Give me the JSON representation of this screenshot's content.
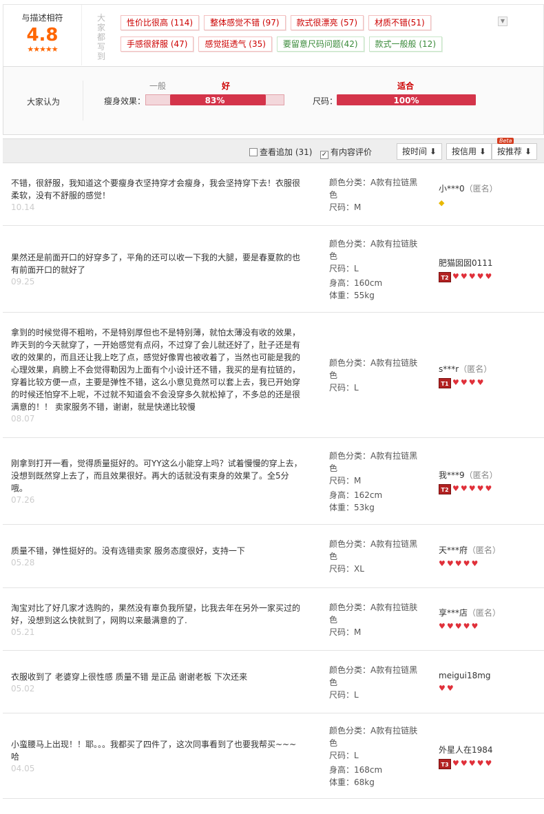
{
  "summary": {
    "score_label": "与描述相符",
    "score": "4.8",
    "stars": "★★★★★",
    "side_label": "大家都写到",
    "tags": [
      {
        "text": "性价比很高 (114)",
        "sentiment": "positive"
      },
      {
        "text": "整体感觉不错 (97)",
        "sentiment": "positive"
      },
      {
        "text": "款式很漂亮 (57)",
        "sentiment": "positive"
      },
      {
        "text": "材质不错(51)",
        "sentiment": "positive"
      },
      {
        "text": "手感很舒服 (47)",
        "sentiment": "positive"
      },
      {
        "text": "感觉挺透气 (35)",
        "sentiment": "positive"
      },
      {
        "text": "要留意尺码问题(42)",
        "sentiment": "negative"
      },
      {
        "text": "款式一般般 (12)",
        "sentiment": "negative"
      }
    ],
    "expand_icon": "chevron-down-icon"
  },
  "opinion": {
    "title": "大家认为",
    "slimming": {
      "label": "瘦身效果：",
      "low_text": "一般",
      "high_text": "好",
      "percent": "83%",
      "fill": 0.83
    },
    "size": {
      "label": "尺码：",
      "high_text": "适合",
      "percent": "100%",
      "fill": 1.0
    }
  },
  "filters": {
    "followup_label": "查看追加 (31)",
    "followup_checked": false,
    "content_label": "有内容评价",
    "content_checked": true,
    "sort_time": "按时间",
    "sort_credit": "按信用",
    "sort_recommend": "按推荐",
    "beta": "Beta"
  },
  "reviews": [
    {
      "text": "不错，很舒服，我知道这个要瘦身衣坚持穿才会瘦身，我会坚持穿下去！衣服很柔软，没有不舒服的感觉！",
      "date": "10.14",
      "color_label": "颜色分类：",
      "color": "A款有拉链黑色",
      "size_label": "尺码：",
      "size": "M",
      "height": "",
      "weight": "",
      "user": "小***0",
      "anon": "（匿名）",
      "level": "",
      "hearts": 0,
      "diamonds": 1
    },
    {
      "text": "果然还是前面开口的好穿多了，平角的还可以收一下我的大腿，要是春夏款的也有前面开口的就好了",
      "date": "09.25",
      "color_label": "颜色分类：",
      "color": "A款有拉链肤色",
      "size_label": "尺码：",
      "size": "L",
      "height_label": "身高：",
      "height": "160cm",
      "weight_label": "体重：",
      "weight": "55kg",
      "user": "肥猫囡囡0111",
      "anon": "",
      "level": "T2",
      "hearts": 5,
      "diamonds": 0
    },
    {
      "text": "拿到的时候觉得不粗哟，不是特别厚但也不是特别薄，就怕太薄没有收的效果，昨天到的今天就穿了，一开始感觉有点闷，不过穿了会儿就还好了，肚子还是有收的效果的，而且还让我上吃了点，感觉好像胃也被收着了，当然也可能是我的心理效果，肩膀上不会觉得勒因为上面有个小设计还不错，我买的是有拉链的，穿着比较方便一点，主要是弹性不错，这么小意见竟然可以套上去，我已开始穿的时候还怕穿不上呢，不过就不知道会不会没穿多久就松掉了，不多总的还是很满意的！！ 卖家服务不错，谢谢，就是快递比较慢",
      "date": "08.07",
      "color_label": "颜色分类：",
      "color": "A款有拉链肤色",
      "size_label": "尺码：",
      "size": "L",
      "height": "",
      "weight": "",
      "user": "s***r",
      "anon": "（匿名）",
      "level": "T1",
      "hearts": 4,
      "diamonds": 0
    },
    {
      "text": "刚拿到打开一看，觉得质量挺好的。可YY这么小能穿上吗？试着慢慢的穿上去，没想到既然穿上去了，而且效果很好。再大的话就没有束身的效果了。全5分哦。",
      "date": "07.26",
      "color_label": "颜色分类：",
      "color": "A款有拉链黑色",
      "size_label": "尺码：",
      "size": "M",
      "height_label": "身高：",
      "height": "162cm",
      "weight_label": "体重：",
      "weight": "53kg",
      "user": "我***9",
      "anon": "（匿名）",
      "level": "T2",
      "hearts": 5,
      "diamonds": 0
    },
    {
      "text": "质量不错，弹性挺好的。没有选错卖家 服务态度很好，支持一下",
      "date": "05.28",
      "color_label": "颜色分类：",
      "color": "A款有拉链黑色",
      "size_label": "尺码：",
      "size": "XL",
      "height": "",
      "weight": "",
      "user": "天***府",
      "anon": "（匿名）",
      "level": "",
      "hearts": 5,
      "diamonds": 0
    },
    {
      "text": "淘宝对比了好几家才选购的，果然没有辜负我所望，比我去年在另外一家买过的好，没想到这么快就到了，网购以来最满意的了.",
      "date": "05.21",
      "color_label": "颜色分类：",
      "color": "A款有拉链肤色",
      "size_label": "尺码：",
      "size": "M",
      "height": "",
      "weight": "",
      "user": "享***店",
      "anon": "（匿名）",
      "level": "",
      "hearts": 5,
      "diamonds": 0
    },
    {
      "text": "衣服收到了 老婆穿上很性感 质量不错 是正品 谢谢老板 下次还来",
      "date": "05.02",
      "color_label": "颜色分类：",
      "color": "A款有拉链黑色",
      "size_label": "尺码：",
      "size": "L",
      "height": "",
      "weight": "",
      "user": "meigui18mg",
      "anon": "",
      "level": "",
      "hearts": 2,
      "diamonds": 0
    },
    {
      "text": "小蛮腰马上出现！！耶。。。我都买了四件了，这次同事看到了也要我帮买~~~哈",
      "date": "04.05",
      "color_label": "颜色分类：",
      "color": "A款有拉链肤色",
      "size_label": "尺码：",
      "size": "L",
      "height_label": "身高：",
      "height": "168cm",
      "weight_label": "体重：",
      "weight": "68kg",
      "user": "外星人在1984",
      "anon": "",
      "level": "T3",
      "hearts": 5,
      "diamonds": 0
    }
  ]
}
